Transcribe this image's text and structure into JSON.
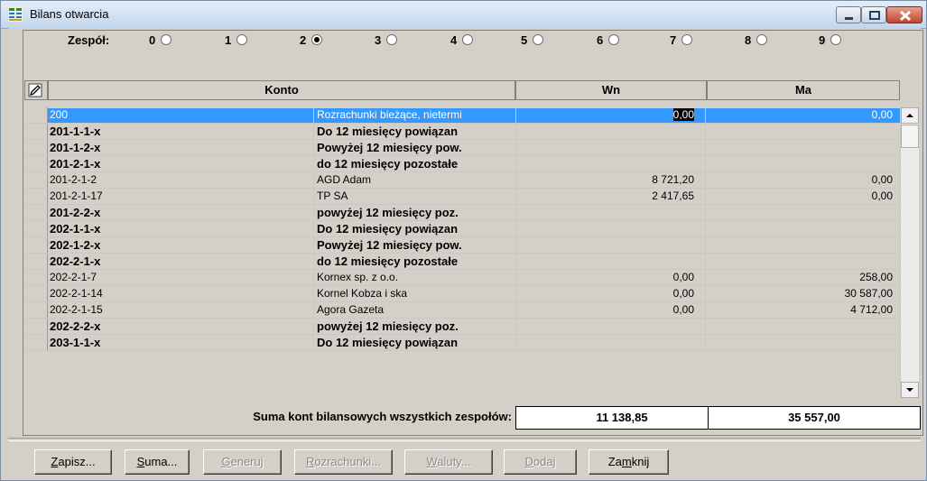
{
  "window": {
    "title": "Bilans otwarcia"
  },
  "team": {
    "label": "Zespół:",
    "selected": 2,
    "options": [
      "0",
      "1",
      "2",
      "3",
      "4",
      "5",
      "6",
      "7",
      "8",
      "9"
    ]
  },
  "grid": {
    "columns": {
      "konto": "Konto",
      "wn": "Wn",
      "ma": "Ma"
    },
    "rows": [
      {
        "account": "200",
        "name": "Rozrachunki bieżące, nietermi",
        "wn": "0,00",
        "ma": "0,00",
        "bold": false,
        "selected": true
      },
      {
        "account": "201-1-1-x",
        "name": "Do 12 miesięcy powiązan",
        "wn": "",
        "ma": "",
        "bold": true,
        "selected": false
      },
      {
        "account": "201-1-2-x",
        "name": "Powyżej 12 miesięcy pow.",
        "wn": "",
        "ma": "",
        "bold": true,
        "selected": false
      },
      {
        "account": "201-2-1-x",
        "name": "do 12 miesięcy pozostałe",
        "wn": "",
        "ma": "",
        "bold": true,
        "selected": false
      },
      {
        "account": "201-2-1-2",
        "name": "AGD Adam",
        "wn": "8 721,20",
        "ma": "0,00",
        "bold": false,
        "selected": false
      },
      {
        "account": "201-2-1-17",
        "name": "TP SA",
        "wn": "2 417,65",
        "ma": "0,00",
        "bold": false,
        "selected": false
      },
      {
        "account": "201-2-2-x",
        "name": "powyżej 12 miesięcy poz.",
        "wn": "",
        "ma": "",
        "bold": true,
        "selected": false
      },
      {
        "account": "202-1-1-x",
        "name": "Do 12 miesięcy powiązan",
        "wn": "",
        "ma": "",
        "bold": true,
        "selected": false
      },
      {
        "account": "202-1-2-x",
        "name": "Powyżej 12 miesięcy pow.",
        "wn": "",
        "ma": "",
        "bold": true,
        "selected": false
      },
      {
        "account": "202-2-1-x",
        "name": "do 12 miesięcy pozostałe",
        "wn": "",
        "ma": "",
        "bold": true,
        "selected": false
      },
      {
        "account": "202-2-1-7",
        "name": "Kornex sp. z o.o.",
        "wn": "0,00",
        "ma": "258,00",
        "bold": false,
        "selected": false
      },
      {
        "account": "202-2-1-14",
        "name": "Kornel Kobza i ska",
        "wn": "0,00",
        "ma": "30 587,00",
        "bold": false,
        "selected": false
      },
      {
        "account": "202-2-1-15",
        "name": "Agora Gazeta",
        "wn": "0,00",
        "ma": "4 712,00",
        "bold": false,
        "selected": false
      },
      {
        "account": "202-2-2-x",
        "name": "powyżej 12 miesięcy poz.",
        "wn": "",
        "ma": "",
        "bold": true,
        "selected": false
      },
      {
        "account": "203-1-1-x",
        "name": "Do 12 miesięcy powiązan",
        "wn": "",
        "ma": "",
        "bold": true,
        "selected": false
      }
    ]
  },
  "summary": {
    "label": "Suma kont bilansowych wszystkich zespołów:",
    "wn": "11 138,85",
    "ma": "35 557,00"
  },
  "buttons": [
    {
      "id": "save",
      "pre": "",
      "hot": "Z",
      "post": "apisz...",
      "disabled": false
    },
    {
      "id": "sum",
      "pre": "",
      "hot": "S",
      "post": "uma...",
      "disabled": false
    },
    {
      "id": "generate",
      "pre": "",
      "hot": "G",
      "post": "eneruj",
      "disabled": true
    },
    {
      "id": "settlements",
      "pre": "",
      "hot": "R",
      "post": "ozrachunki...",
      "disabled": true
    },
    {
      "id": "currencies",
      "pre": "",
      "hot": "W",
      "post": "aluty...",
      "disabled": true
    },
    {
      "id": "add",
      "pre": "",
      "hot": "D",
      "post": "odaj",
      "disabled": true
    },
    {
      "id": "close",
      "pre": "Za",
      "hot": "m",
      "post": "knij",
      "disabled": false
    }
  ]
}
